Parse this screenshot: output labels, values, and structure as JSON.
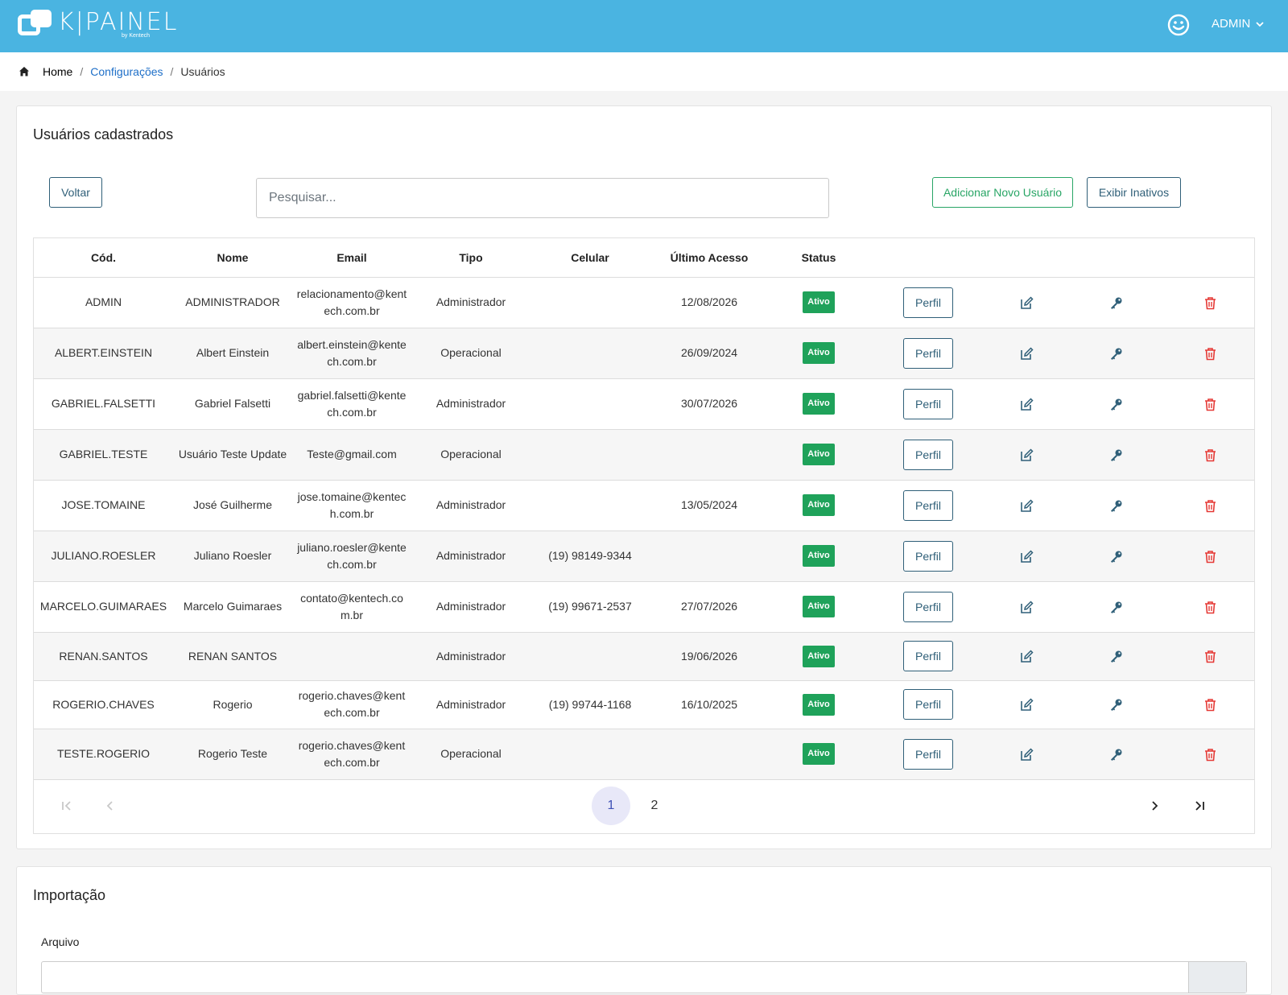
{
  "header": {
    "logo_text": "K|PAINEL",
    "logo_sub": "by Kentech",
    "user_label": "ADMIN"
  },
  "breadcrumb": {
    "home": "Home",
    "config": "Configurações",
    "current": "Usuários",
    "separator": "/"
  },
  "users_card": {
    "title": "Usuários cadastrados",
    "back_label": "Voltar",
    "search_placeholder": "Pesquisar...",
    "add_label": "Adicionar Novo Usuário",
    "inactive_label": "Exibir Inativos"
  },
  "table": {
    "columns": [
      "Cód.",
      "Nome",
      "Email",
      "Tipo",
      "Celular",
      "Último Acesso",
      "Status"
    ],
    "perfil_label": "Perfil",
    "rows": [
      {
        "code": "ADMIN",
        "name": "ADMINISTRADOR",
        "email": "relacionamento@kentech.com.br",
        "type": "Administrador",
        "phone": "",
        "last": "12/08/2026",
        "status": "Ativo"
      },
      {
        "code": "ALBERT.EINSTEIN",
        "name": "Albert Einstein",
        "email": "albert.einstein@kentech.com.br",
        "type": "Operacional",
        "phone": "",
        "last": "26/09/2024",
        "status": "Ativo"
      },
      {
        "code": "GABRIEL.FALSETTI",
        "name": "Gabriel Falsetti",
        "email": "gabriel.falsetti@kentech.com.br",
        "type": "Administrador",
        "phone": "",
        "last": "30/07/2026",
        "status": "Ativo"
      },
      {
        "code": "GABRIEL.TESTE",
        "name": "Usuário Teste Update",
        "email": "Teste@gmail.com",
        "type": "Operacional",
        "phone": "",
        "last": "",
        "status": "Ativo"
      },
      {
        "code": "JOSE.TOMAINE",
        "name": "José Guilherme",
        "email": "jose.tomaine@kentech.com.br",
        "type": "Administrador",
        "phone": "",
        "last": "13/05/2024",
        "status": "Ativo"
      },
      {
        "code": "JULIANO.ROESLER",
        "name": "Juliano Roesler",
        "email": "juliano.roesler@kentech.com.br",
        "type": "Administrador",
        "phone": "(19) 98149-9344",
        "last": "",
        "status": "Ativo"
      },
      {
        "code": "MARCELO.GUIMARAES",
        "name": "Marcelo Guimaraes",
        "email": "contato@kentech.com.br",
        "type": "Administrador",
        "phone": "(19) 99671-2537",
        "last": "27/07/2026",
        "status": "Ativo"
      },
      {
        "code": "RENAN.SANTOS",
        "name": "RENAN SANTOS",
        "email": "",
        "type": "Administrador",
        "phone": "",
        "last": "19/06/2026",
        "status": "Ativo"
      },
      {
        "code": "ROGERIO.CHAVES",
        "name": "Rogerio",
        "email": "rogerio.chaves@kentech.com.br",
        "type": "Administrador",
        "phone": "(19) 99744-1168",
        "last": "16/10/2025",
        "status": "Ativo"
      },
      {
        "code": "TESTE.ROGERIO",
        "name": "Rogerio Teste",
        "email": "rogerio.chaves@kentech.com.br",
        "type": "Operacional",
        "phone": "",
        "last": "",
        "status": "Ativo"
      }
    ]
  },
  "pagination": {
    "pages": [
      "1",
      "2"
    ],
    "current": "1"
  },
  "import_card": {
    "title": "Importação",
    "file_label": "Arquivo"
  },
  "colors": {
    "header_bg": "#4ab4e1",
    "status_green": "#1fa25a",
    "danger_red": "#e53935",
    "action_blue": "#2f5f78"
  }
}
